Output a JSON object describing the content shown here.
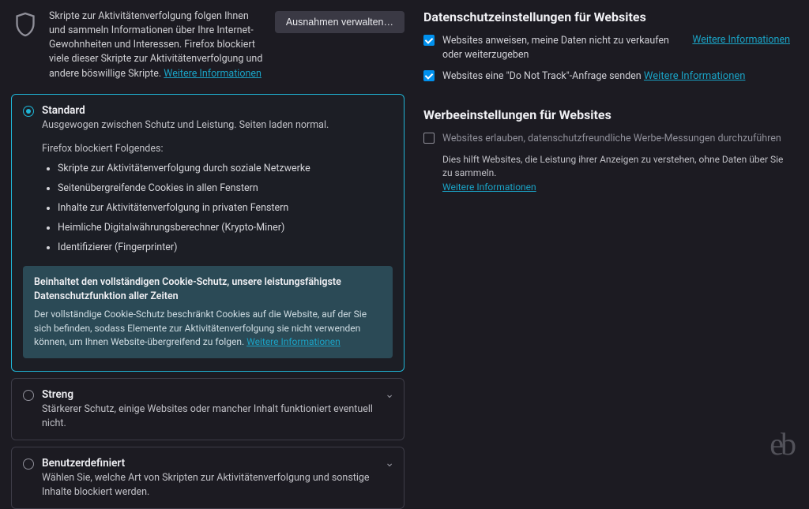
{
  "intro": {
    "text_part1": "Skripte zur Aktivitätenverfolgung folgen Ihnen und sammeln Informationen über Ihre Internet-Gewohnheiten und Interessen. Firefox blockiert viele dieser Skripte zur Aktivitätenverfolgung und andere böswillige Skripte. ",
    "learn_more": "Weitere Informationen",
    "manage_exceptions": "Ausnahmen verwalten…"
  },
  "protection": {
    "standard": {
      "title": "Standard",
      "subtitle": "Ausgewogen zwischen Schutz und Leistung. Seiten laden normal.",
      "blocks_label": "Firefox blockiert Folgendes:",
      "items": [
        "Skripte zur Aktivitätenverfolgung durch soziale Netzwerke",
        "Seitenübergreifende Cookies in allen Fenstern",
        "Inhalte zur Aktivitätenverfolgung in privaten Fenstern",
        "Heimliche Digitalwährungsberechner (Krypto-Miner)",
        "Identifizierer (Fingerprinter)"
      ],
      "infobox_title": "Beinhaltet den vollständigen Cookie-Schutz, unsere leistungsfähigste Datenschutzfunktion aller Zeiten",
      "infobox_text": "Der vollständige Cookie-Schutz beschränkt Cookies auf die Website, auf der Sie sich befinden, sodass Elemente zur Aktivitätenverfolgung sie nicht verwenden können, um Ihnen Website-übergreifend zu folgen. ",
      "infobox_link": "Weitere Informationen"
    },
    "strict": {
      "title": "Streng",
      "subtitle": "Stärkerer Schutz, einige Websites oder mancher Inhalt funktioniert eventuell nicht."
    },
    "custom": {
      "title": "Benutzerdefiniert",
      "subtitle": "Wählen Sie, welche Art von Skripten zur Aktivitätenverfolgung und sonstige Inhalte blockiert werden."
    }
  },
  "privacy": {
    "heading": "Datenschutzeinstellungen für Websites",
    "do_not_sell_label": "Websites anweisen, meine Daten nicht zu verkaufen oder weiterzugeben",
    "do_not_sell_link": "Weitere Informationen",
    "dnt_label": "Websites eine \"Do Not Track\"-Anfrage senden",
    "dnt_link": "Weitere Informationen"
  },
  "ads": {
    "heading": "Werbeeinstellungen für Websites",
    "allow_label": "Websites erlauben, datenschutzfreundliche Werbe-Messungen durchzuführen",
    "desc": "Dies hilft Websites, die Leistung ihrer Anzeigen zu verstehen, ohne Daten über Sie zu sammeln.",
    "link": "Weitere Informationen"
  },
  "watermark": "eb"
}
